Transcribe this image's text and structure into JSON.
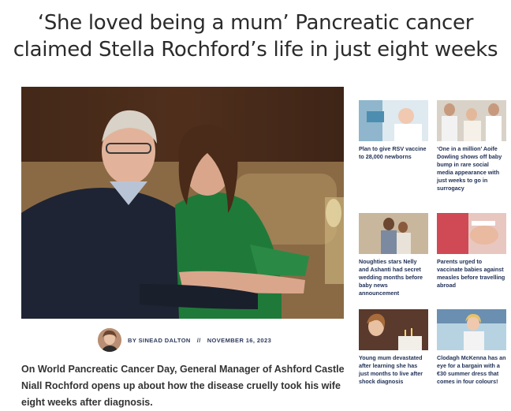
{
  "article": {
    "headline_line1": "‘She loved being a mum’ Pancreatic cancer",
    "headline_line2": "claimed Stella Rochford’s life in just eight weeks",
    "byline": {
      "author": "BY SINEAD DALTON",
      "separator": "//",
      "date": "NOVEMBER 16, 2023"
    },
    "lede": "On World Pancreatic Cancer Day, General Manager of Ashford Castle Niall Rochford opens up about how the disease cruelly took his wife eight weeks after diagnosis."
  },
  "related": [
    {
      "title": "Plan to give RSV vaccine to 28,000 newborns"
    },
    {
      "title": "‘One in a million’ Aoife Dowling shows off baby bump in rare social media appearance with just weeks to go in surrogacy"
    },
    {
      "title": "Noughties stars Nelly and Ashanti had secret wedding months before baby news announcement"
    },
    {
      "title": "Parents urged to vaccinate babies against measles before travelling abroad"
    },
    {
      "title": "Young mum devastated after learning she has just months to live after shock diagnosis"
    },
    {
      "title": "Clodagh McKenna has an eye for a bargain with a €30 summer dress that comes in four colours!"
    }
  ],
  "colors": {
    "link_navy": "#1f2f55",
    "headline": "#2b2b2b"
  }
}
